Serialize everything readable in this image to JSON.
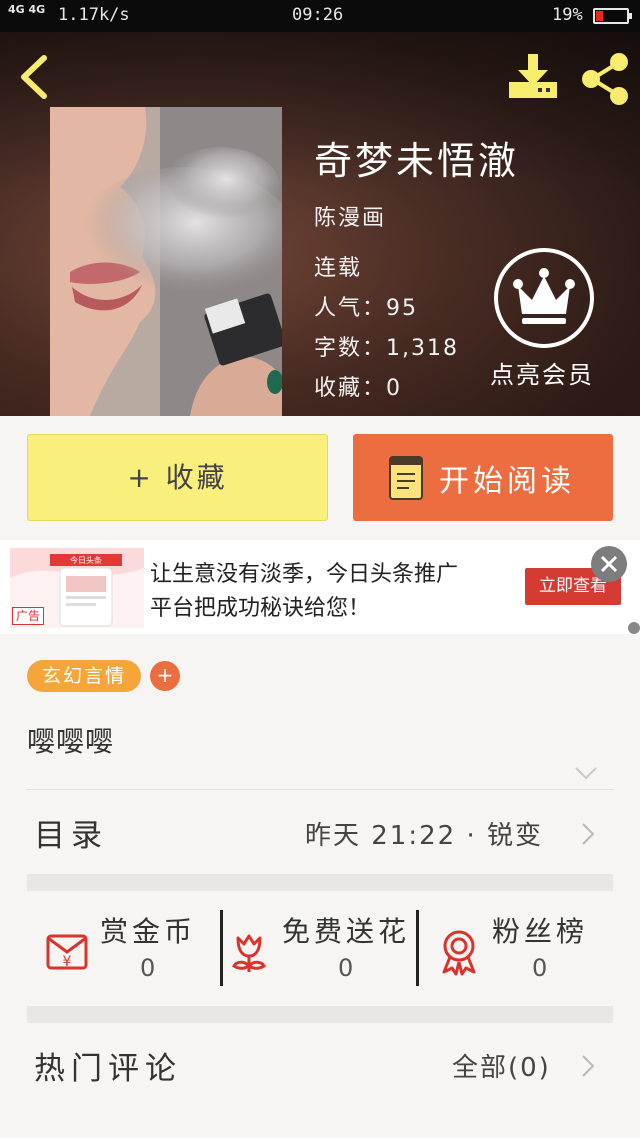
{
  "status_bar": {
    "network": "4G 4G",
    "speed": "1.17k/s",
    "time": "09:26",
    "battery": "19%",
    "battery_level": 0.19
  },
  "book": {
    "title": "奇梦未悟澈",
    "author": "陈漫画",
    "status": "连载",
    "popularity_label": "人气：",
    "popularity": "95",
    "words_label": "字数：",
    "words": "1,318",
    "favorites_label": "收藏：",
    "favorites": "0",
    "vip_label": "点亮会员"
  },
  "actions": {
    "collect": "+ 收藏",
    "read": "开始阅读"
  },
  "ad": {
    "line1": "让生意没有淡季，今日头条推广",
    "line2": "平台把成功秘诀给您！",
    "cta": "立即查看",
    "tag": "广告",
    "thumb_brand": "今日头条"
  },
  "genre_tag": "玄幻言情",
  "add_tag": "+",
  "description": "嘤嘤嘤",
  "catalog": {
    "label": "目录",
    "latest": "昨天 21:22 · 锐变"
  },
  "stats": [
    {
      "name": "赏金币",
      "value": "0",
      "icon": "red-envelope-icon"
    },
    {
      "name": "免费送花",
      "value": "0",
      "icon": "flower-icon"
    },
    {
      "name": "粉丝榜",
      "value": "0",
      "icon": "medal-icon"
    }
  ],
  "comments": {
    "label": "热门评论",
    "all": "全部(0)"
  },
  "colors": {
    "accent_orange": "#ec6d3f",
    "collect_yellow": "#f9ef7d",
    "tag_orange": "#f6a53b",
    "icon_red": "#d9342b",
    "header_icon_yellow": "#f7ec6e"
  }
}
